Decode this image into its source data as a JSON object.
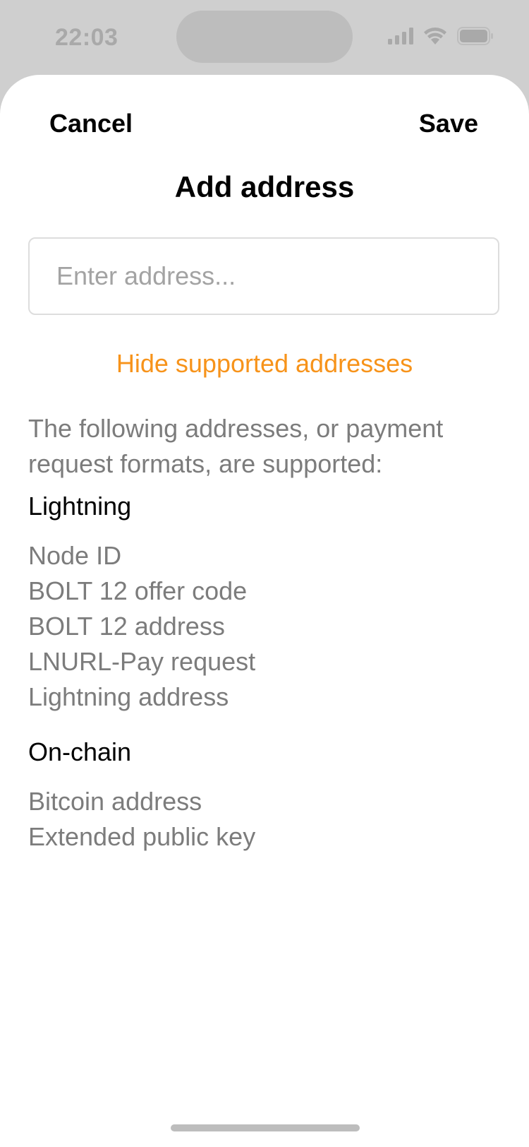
{
  "status_bar": {
    "time": "22:03",
    "icons": [
      "signal-icon",
      "wifi-icon",
      "battery-icon"
    ]
  },
  "sheet": {
    "cancel_label": "Cancel",
    "save_label": "Save",
    "title": "Add address",
    "address_input": {
      "placeholder": "Enter address...",
      "value": ""
    },
    "toggle_label": "Hide supported addresses",
    "intro": "The following addresses, or payment request formats, are supported:",
    "sections": [
      {
        "heading": "Lightning",
        "items": [
          "Node ID",
          "BOLT 12 offer code",
          "BOLT 12 address",
          "LNURL-Pay request",
          "Lightning address"
        ]
      },
      {
        "heading": "On-chain",
        "items": [
          "Bitcoin address",
          "Extended public key"
        ]
      }
    ]
  },
  "colors": {
    "accent": "#f7931a",
    "secondary_text": "#7c7c7c",
    "placeholder": "#a3a3a3",
    "backdrop": "#cfcfcf"
  }
}
